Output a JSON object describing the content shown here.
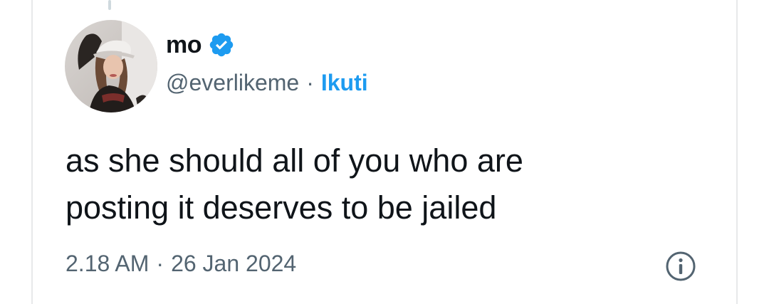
{
  "tweet": {
    "author": {
      "display_name": "mo",
      "verified": true,
      "handle": "@everlikeme",
      "avatar_icon": "profile-photo"
    },
    "separator": "·",
    "translate_label": "Ikuti",
    "text_lines": [
      "as she should all of you who are",
      "posting it deserves to be jailed"
    ],
    "timestamp": {
      "time": "2.18 AM",
      "separator": "·",
      "date": "26 Jan 2024"
    },
    "info_icon": "info-icon"
  },
  "colors": {
    "text_primary": "#0f1419",
    "text_secondary": "#536471",
    "accent": "#1d9bf0",
    "border": "#e7e9ea"
  }
}
